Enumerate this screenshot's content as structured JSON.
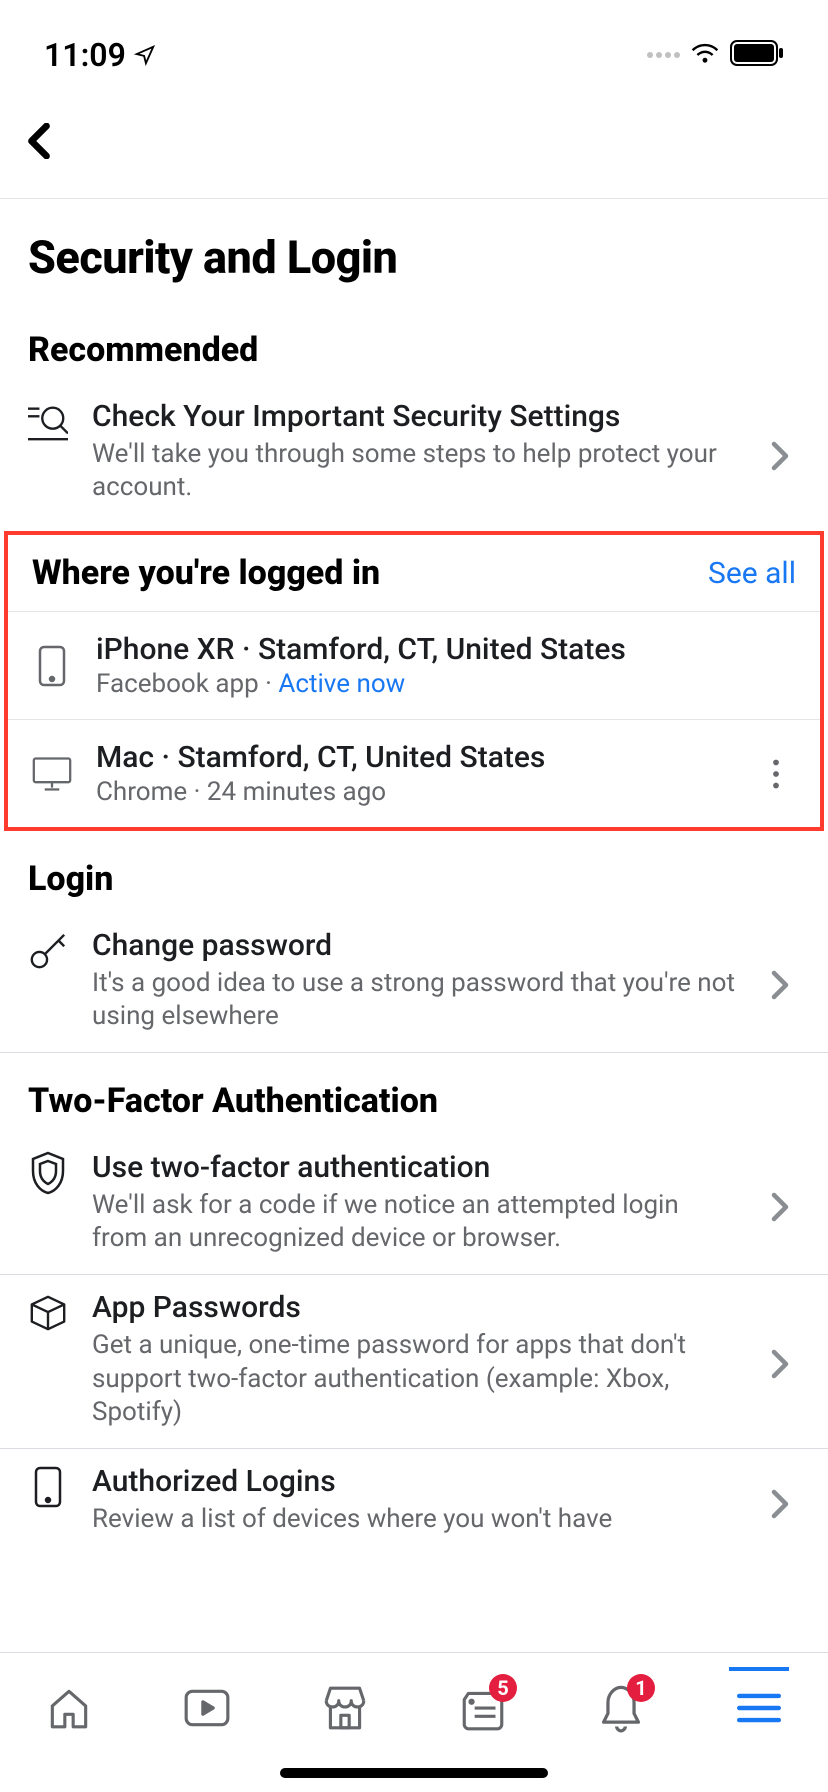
{
  "status_bar": {
    "time": "11:09"
  },
  "page": {
    "title": "Security and Login"
  },
  "sections": {
    "recommended": {
      "title": "Recommended",
      "item": {
        "title": "Check Your Important Security Settings",
        "subtitle": "We'll take you through some steps to help protect your account."
      }
    },
    "where_logged_in": {
      "title": "Where you're logged in",
      "see_all": "See all",
      "devices": [
        {
          "title": "iPhone XR · Stamford, CT, United States",
          "app": "Facebook app · ",
          "status": "Active now"
        },
        {
          "title": "Mac · Stamford, CT, United States",
          "app": "Chrome · 24 minutes ago",
          "status": ""
        }
      ]
    },
    "login": {
      "title": "Login",
      "item": {
        "title": "Change password",
        "subtitle": "It's a good idea to use a strong password that you're not using elsewhere"
      }
    },
    "two_factor": {
      "title": "Two-Factor Authentication",
      "items": [
        {
          "title": "Use two-factor authentication",
          "subtitle": "We'll ask for a code if we notice an attempted login from an unrecognized device or browser."
        },
        {
          "title": "App Passwords",
          "subtitle": "Get a unique, one-time password for apps that don't support two-factor authentication (example: Xbox, Spotify)"
        },
        {
          "title": "Authorized Logins",
          "subtitle": "Review a list of devices where you won't have"
        }
      ]
    }
  },
  "nav": {
    "news_badge": "5",
    "notif_badge": "1"
  }
}
